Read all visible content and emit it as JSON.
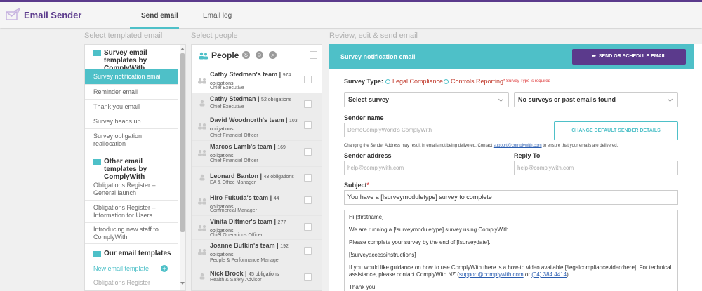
{
  "app": {
    "title": "Email Sender",
    "logo_icon": "envelope-send-icon"
  },
  "tabs": [
    {
      "label": "Send email",
      "active": true
    },
    {
      "label": "Email log",
      "active": false
    }
  ],
  "columns": {
    "templates": "Select templated email",
    "people": "Select people",
    "review": "Review, edit & send email"
  },
  "templates": {
    "group1_title": "Survey email templates by ComplyWith",
    "group1_items": [
      "Survey notification email",
      "Reminder email",
      "Thank you email",
      "Survey heads up",
      "Survey obligation reallocation"
    ],
    "group2_title": "Other email templates by ComplyWith",
    "group2_items": [
      "Obligations Register – General launch",
      "Obligations Register – Information for Users",
      "Introducing new staff to ComplyWith"
    ],
    "group3_title": "Our email templates",
    "new_template": "New email template",
    "partial_item": "Obligations Register"
  },
  "people": {
    "title": "People",
    "items": [
      {
        "name": "Cathy Stedman's team",
        "count": "974 obligations",
        "role": "Chief Executive",
        "enabled": true
      },
      {
        "name": "Cathy Stedman",
        "count": "52 obligations",
        "role": "Chief Executive",
        "enabled": false
      },
      {
        "name": "David Woodnorth's team",
        "count": "103 obligations",
        "role": "Chief Financial Officer",
        "enabled": false
      },
      {
        "name": "Marcos Lamb's team",
        "count": "169 obligations",
        "role": "Chief Financial Officer",
        "enabled": false
      },
      {
        "name": "Leonard Banton",
        "count": "43 obligations",
        "role": "EA & Office Manager",
        "enabled": false
      },
      {
        "name": "Hiro Fukuda's team",
        "count": "44 obligations",
        "role": "Commercial Manager",
        "enabled": false
      },
      {
        "name": "Vinita Dittmer's team",
        "count": "277 obligations",
        "role": "Chief Operations Officer",
        "enabled": false
      },
      {
        "name": "Joanne Bufkin's team",
        "count": "192 obligations",
        "role": "People & Performance Manager",
        "enabled": false
      },
      {
        "name": "Nick Brook",
        "count": "45 obligations",
        "role": "Health & Safety Advisor",
        "enabled": false
      }
    ]
  },
  "review": {
    "title": "Survey notification email",
    "send_button": "SEND OR SCHEDULE EMAIL",
    "survey_type_label": "Survey Type:",
    "survey_type_options": [
      "Legal Compliance",
      "Controls Reporting"
    ],
    "survey_type_required": "* Survey Type is required",
    "select_survey": "Select survey",
    "no_surveys": "No surveys or past emails found",
    "sender_name_label": "Sender name",
    "sender_name_placeholder": "DemoComplyWorld's ComplyWith",
    "change_sender_button": "CHANGE DEFAULT SENDER DETAILS",
    "note_prefix": "Changing the Sender Address may result in emails not being delivered. Contact",
    "note_link": "support@complywith.com",
    "note_suffix": "to ensure that your emails are delivered.",
    "sender_address_label": "Sender address",
    "sender_address_placeholder": "help@complywith.com",
    "reply_to_label": "Reply To",
    "reply_to_placeholder": "help@complywith.com",
    "subject_label": "Subject",
    "subject_value": "You have a [!surveymoduletype] survey to complete",
    "body": {
      "line1": "Hi [!firstname]",
      "line2": "We are running a [!surveymoduletype] survey using ComplyWith.",
      "line3": "Please complete your survey by the end of [!surveydate].",
      "line4": "[!surveyaccessinstructions]",
      "line5a": "If you would like guidance on how to use ComplyWith there is a how-to video available [!legalcompliancevideo:here]. For technical assistance, please contact ComplyWith NZ (",
      "line5_link": "support@complywith.com",
      "line5_or": " or ",
      "line5_phone": "(04) 384 4414",
      "line5_end": ").",
      "line6": "Thank you"
    }
  },
  "colors": {
    "accent": "#4ec0c8",
    "brand": "#5b3a8c",
    "required": "#d33"
  }
}
